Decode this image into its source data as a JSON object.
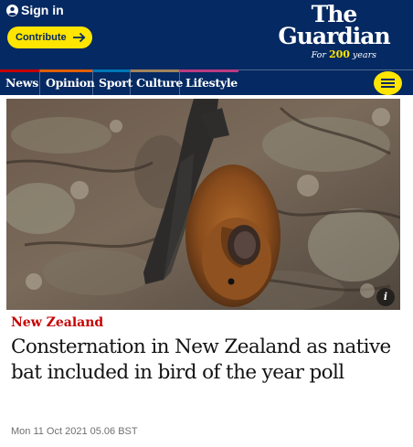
{
  "header": {
    "signin_label": "Sign in",
    "contribute_label": "Contribute",
    "logo_line1": "The",
    "logo_line2": "Guardian",
    "logo_tag_prefix": "For ",
    "logo_tag_number": "200",
    "logo_tag_suffix": " years"
  },
  "nav": {
    "items": [
      {
        "label": "News",
        "color": "#c70000"
      },
      {
        "label": "Opinion",
        "color": "#e05e00"
      },
      {
        "label": "Sport",
        "color": "#0077b6"
      },
      {
        "label": "Culture",
        "color": "#a1845c"
      },
      {
        "label": "Lifestyle",
        "color": "#bb3b80"
      }
    ],
    "menu_icon": "hamburger-icon"
  },
  "image": {
    "info_label": "i",
    "description_icon": "info-icon"
  },
  "article": {
    "kicker": "New Zealand",
    "headline": "Consternation in New Zealand as native bat included in bird of the year poll",
    "dateline": "Mon 11 Oct 2021 05.06 BST"
  },
  "colors": {
    "brand_blue": "#052962",
    "accent_yellow": "#ffe500",
    "news_red": "#c70000"
  }
}
